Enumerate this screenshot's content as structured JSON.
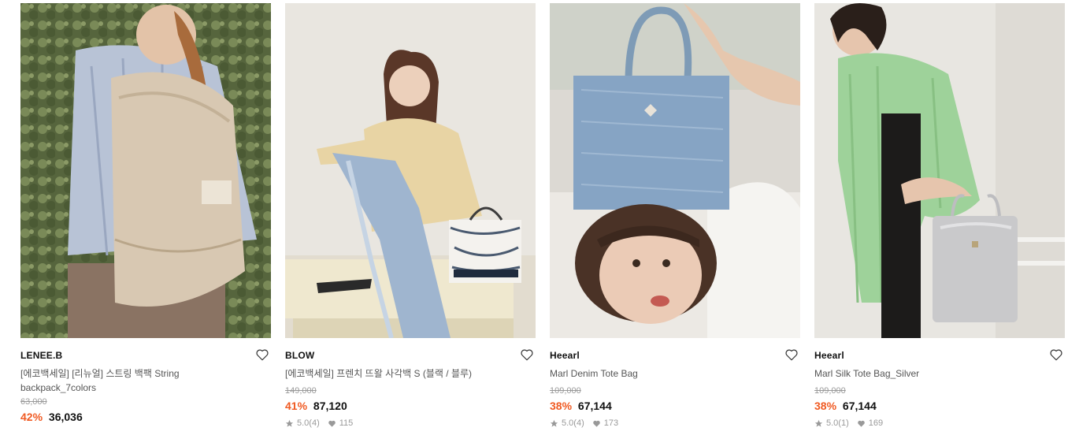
{
  "products": [
    {
      "brand": "LENEE.B",
      "name": "[에코백세일] [리뉴얼] 스트링 백팩 String backpack_7colors",
      "original_price": "63,000",
      "discount": "42%",
      "price": "36,036",
      "rating": "",
      "reviews": "",
      "likes": "",
      "image_icon": "model-with-backpack-photo"
    },
    {
      "brand": "BLOW",
      "name": "[에코백세일] 프렌치 뜨왈 사각백 S (블랙 / 블루)",
      "original_price": "149,000",
      "discount": "41%",
      "price": "87,120",
      "rating": "5.0",
      "reviews": "(4)",
      "likes": "115",
      "image_icon": "model-with-tote-photo"
    },
    {
      "brand": "Heearl",
      "name": "Marl Denim Tote Bag",
      "original_price": "109,000",
      "discount": "38%",
      "price": "67,144",
      "rating": "5.0",
      "reviews": "(4)",
      "likes": "173",
      "image_icon": "denim-tote-photo"
    },
    {
      "brand": "Heearl",
      "name": "Marl Silk Tote Bag_Silver",
      "original_price": "109,000",
      "discount": "38%",
      "price": "67,144",
      "rating": "5.0",
      "reviews": "(1)",
      "likes": "169",
      "image_icon": "silk-tote-photo"
    }
  ],
  "colors": {
    "discount": "#f05a22",
    "muted": "#999999"
  }
}
